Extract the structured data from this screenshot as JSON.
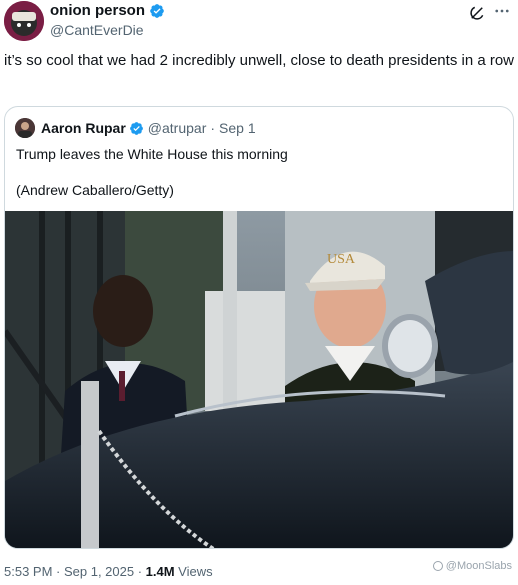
{
  "tweet": {
    "author": {
      "display_name": "onion person",
      "handle": "@CantEverDie",
      "verified": true,
      "avatar_icon": "avatar-icon"
    },
    "text": "it’s so cool that we had 2 incredibly unwell, close to death presidents in a row",
    "timestamp": "5:53 PM · Sep 1, 2025 · ",
    "views_count": "1.4M",
    "views_label": " Views"
  },
  "quote": {
    "author": {
      "display_name": "Aaron Rupar",
      "handle": "@atrupar",
      "verified": true
    },
    "separator": "·",
    "date": "Sep 1",
    "text": "Trump leaves the White House this morning",
    "credit": "(Andrew Caballero/Getty)"
  },
  "watermark": "@MoonSlabs",
  "colors": {
    "verified_blue": "#1d9bf0",
    "muted_text": "#536471",
    "border": "#cfd9de"
  }
}
